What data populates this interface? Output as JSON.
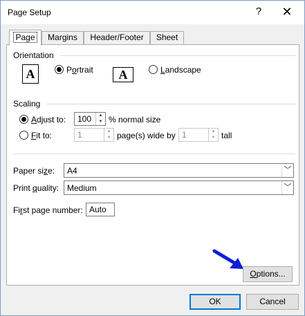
{
  "window": {
    "title": "Page Setup",
    "help_glyph": "?",
    "close_glyph": "✕"
  },
  "tabs": [
    {
      "label": "Page"
    },
    {
      "label": "Margins"
    },
    {
      "label": "Header/Footer"
    },
    {
      "label": "Sheet"
    }
  ],
  "orientation": {
    "label": "Orientation",
    "portrait_label": "Portrait",
    "landscape_label": "Landscape",
    "icon_letter": "A",
    "selected": "portrait"
  },
  "scaling": {
    "label": "Scaling",
    "adjust_label": "Adjust to:",
    "adjust_value": "100",
    "adjust_suffix": "% normal size",
    "fit_label": "Fit to:",
    "fit_wide_value": "1",
    "fit_wide_suffix": "page(s) wide by",
    "fit_tall_value": "1",
    "fit_tall_suffix": "tall",
    "selected": "adjust"
  },
  "paper_size": {
    "label": "Paper size:",
    "value": "A4"
  },
  "print_quality": {
    "label": "Print quality:",
    "value": "Medium"
  },
  "first_page": {
    "label": "First page number:",
    "value": "Auto"
  },
  "buttons": {
    "options": "Options...",
    "ok": "OK",
    "cancel": "Cancel"
  },
  "colors": {
    "annotation_arrow": "#0a1fd6",
    "default_button_border": "#0078d7"
  },
  "icons": {
    "spin_up": "▲",
    "spin_down": "▼",
    "dropdown": "﹀"
  }
}
